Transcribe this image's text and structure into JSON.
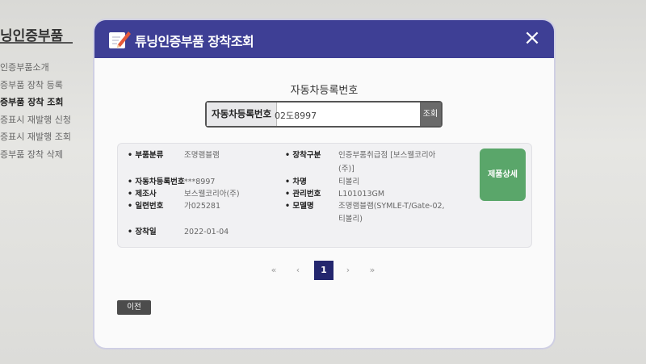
{
  "background": {
    "page_title": "닝인증부품",
    "menu": [
      {
        "label": "인증부품소개"
      },
      {
        "label": "증부품 장착 등록"
      },
      {
        "label": "증부품 장착 조회"
      },
      {
        "label": "증표시 재발행 신청"
      },
      {
        "label": "증표시 재발행 조회"
      },
      {
        "label": "증부품 장착 삭제"
      }
    ],
    "active_menu_index": 2
  },
  "modal": {
    "title": "튜닝인증부품 장착조회",
    "close_icon": "×",
    "header_icon": "pencil-note-icon",
    "header_color": "#3e3f95",
    "search": {
      "heading": "자동차등록번호",
      "label": "자동차등록번호",
      "value": "02도8997",
      "button": "조회"
    },
    "result": {
      "fields": {
        "part_category": {
          "label": "• 부품분류",
          "value": "조명램블램"
        },
        "mount_type": {
          "label": "• 장착구분",
          "value": "인증부품취급점 [보스웰코리아",
          "value2": "(주)]"
        },
        "reg_number": {
          "label": "• 자동차등록번호",
          "value": "***8997"
        },
        "car_name": {
          "label": "• 차명",
          "value": "티볼리"
        },
        "maker": {
          "label": "• 제조사",
          "value": "보스웰코리아(주)"
        },
        "mgmt_number": {
          "label": "• 관리번호",
          "value": "L101013GM"
        },
        "serial_number": {
          "label": "• 일련번호",
          "value": "가025281"
        },
        "model_name": {
          "label": "• 모델명",
          "value": "조명램블램(SYMLE-T/Gate-02,",
          "value2": "티볼리)"
        },
        "mount_date": {
          "label": "• 장착일",
          "value": "2022-01-04"
        }
      },
      "detail_button": "제품상세",
      "detail_button_color": "#5aa66a"
    },
    "pagination": {
      "first": "«",
      "prev": "‹",
      "current": "1",
      "next": "›",
      "last": "»"
    },
    "prev_button": "이전"
  }
}
